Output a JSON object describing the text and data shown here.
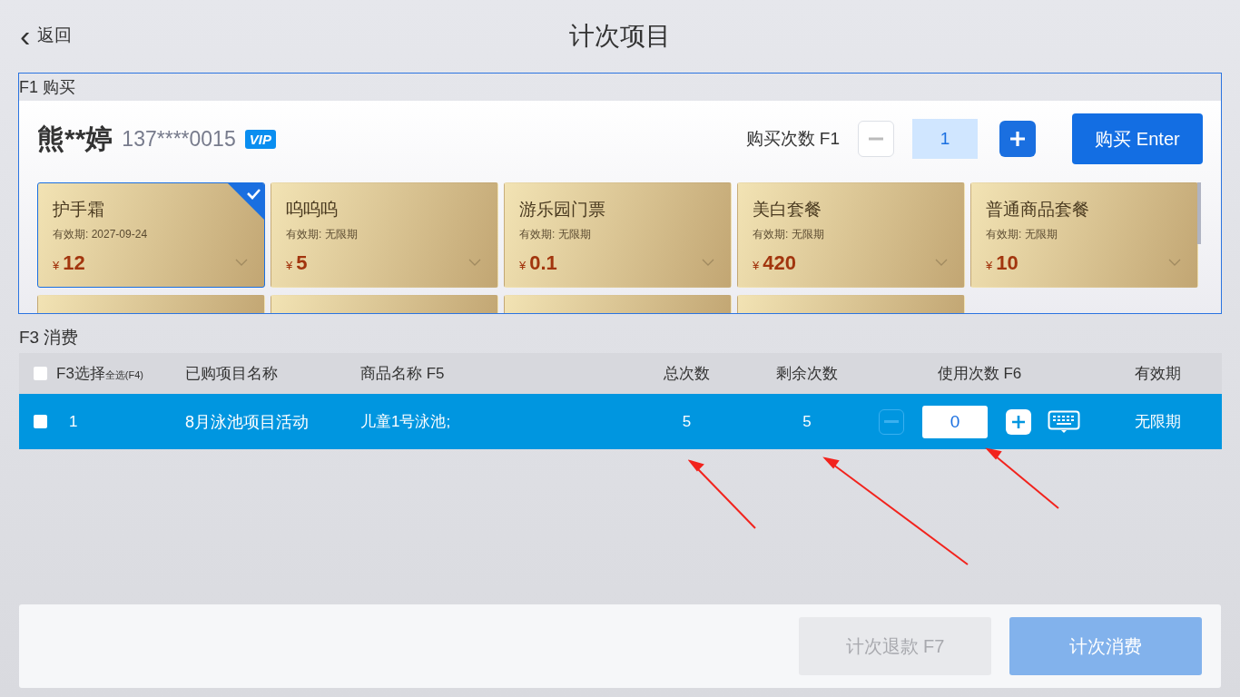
{
  "header": {
    "back": {
      "icon": "‹",
      "label": "返回"
    },
    "title": "计次项目"
  },
  "purchase": {
    "section_label": "F1 购买",
    "customer": {
      "name": "熊**婷",
      "phone": "137****0015",
      "badge": "VIP"
    },
    "quantity": {
      "label": "购买次数 F1",
      "value": "1",
      "minus_disabled": true
    },
    "buy_button": "购买 Enter",
    "cards": [
      {
        "name": "护手霜",
        "validity": "有效期: 2027-09-24",
        "currency": "¥",
        "price": "12",
        "selected": true
      },
      {
        "name": "呜呜呜",
        "validity": "有效期: 无限期",
        "currency": "¥",
        "price": "5",
        "selected": false
      },
      {
        "name": "游乐园门票",
        "validity": "有效期: 无限期",
        "currency": "¥",
        "price": "0.1",
        "selected": false
      },
      {
        "name": "美白套餐",
        "validity": "有效期: 无限期",
        "currency": "¥",
        "price": "420",
        "selected": false
      },
      {
        "name": "普通商品套餐",
        "validity": "有效期: 无限期",
        "currency": "¥",
        "price": "10",
        "selected": false
      }
    ],
    "more_cards": [
      {
        "selected": false
      },
      {
        "selected": false
      },
      {
        "selected": false
      },
      {
        "selected": false
      }
    ]
  },
  "consume": {
    "section_label": "F3 消费",
    "select_all_checked": false,
    "columns": [
      {
        "label": "F3选择",
        "sub": "全选(F4)"
      },
      {
        "label": "已购项目名称"
      },
      {
        "label": "商品名称 F5"
      },
      {
        "label": "总次数"
      },
      {
        "label": "剩余次数"
      },
      {
        "label": "使用次数 F6"
      },
      {
        "label": "有效期"
      }
    ],
    "rows": [
      {
        "checked": false,
        "selected": true,
        "index": "1",
        "project": "8月泳池项目活动",
        "product": "儿童1号泳池;",
        "total": "5",
        "remaining": "5",
        "use_count": "0",
        "minus_disabled": true,
        "validity": "无限期"
      }
    ]
  },
  "footer": {
    "buttons": [
      {
        "label": "计次退款 F7",
        "kind": "secondary",
        "disabled": true
      },
      {
        "label": "计次消费",
        "kind": "primary",
        "disabled": true
      }
    ]
  }
}
